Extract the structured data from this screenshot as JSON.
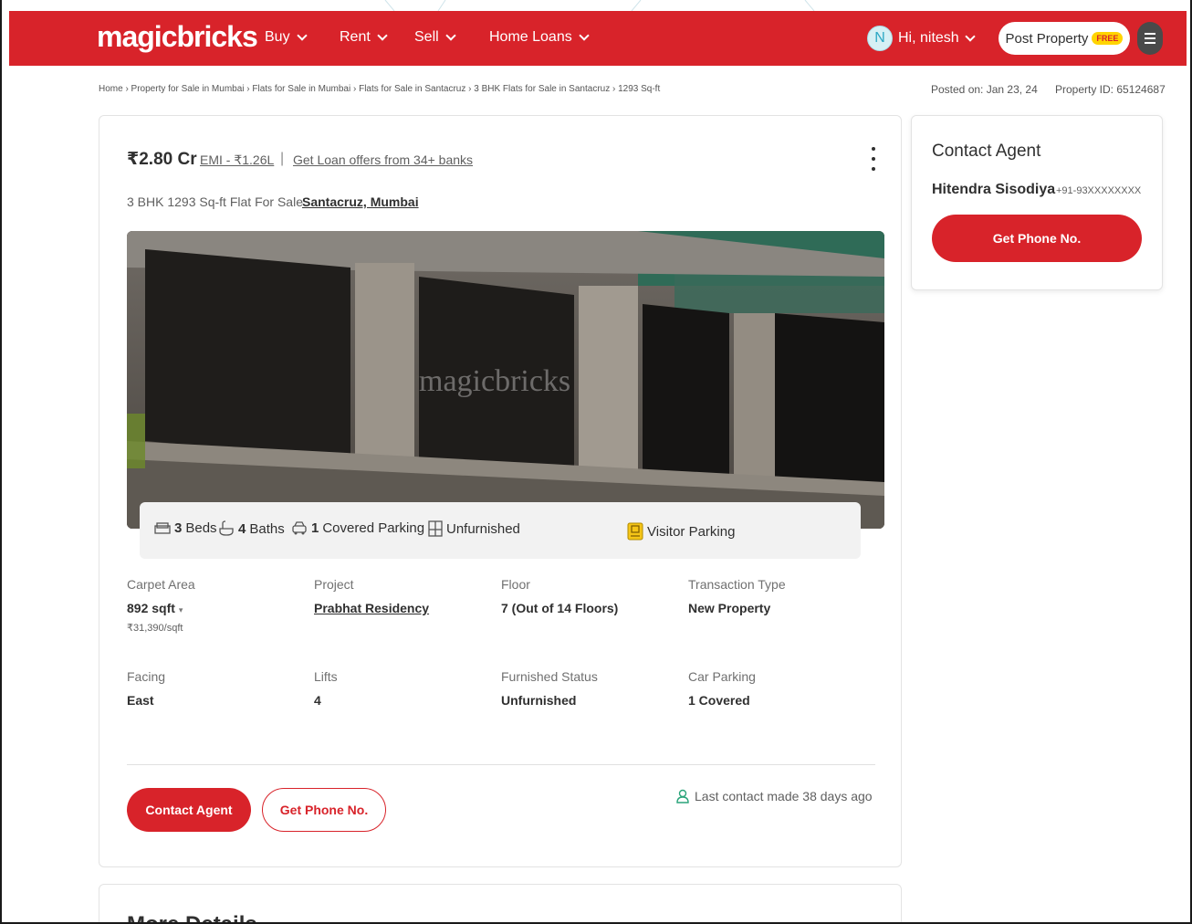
{
  "header": {
    "logo": "magicbricks",
    "nav": [
      "Buy",
      "Rent",
      "Sell",
      "Home Loans"
    ],
    "avatar_initial": "N",
    "greeting": "Hi, nitesh",
    "post_property": "Post Property",
    "free_badge": "FREE"
  },
  "breadcrumb": "Home › Property for Sale in Mumbai › Flats for Sale in Mumbai › Flats for Sale in Santacruz › 3 BHK Flats for Sale in Santacruz › 1293 Sq-ft",
  "posted_on": "Posted on: Jan 23, 24",
  "property_id": "Property ID: 65124687",
  "listing": {
    "price": "₹2.80 Cr",
    "emi": "EMI - ₹1.26L",
    "separator": "|",
    "loan_offer": "Get Loan offers from 34+ banks",
    "subtitle": "3 BHK 1293 Sq-ft Flat For Sale",
    "location": "Santacruz, Mumbai",
    "photo_watermark": "magicbricks"
  },
  "amenities": {
    "beds_count": "3",
    "beds_label": "Beds",
    "baths_count": "4",
    "baths_label": "Baths",
    "parking_count": "1",
    "parking_label": "Covered Parking",
    "furnishing": "Unfurnished",
    "visitor": "Visitor Parking"
  },
  "details": [
    {
      "label": "Carpet Area",
      "value": "892 sqft",
      "sub": "₹31,390/sqft"
    },
    {
      "label": "Project",
      "value": "Prabhat Residency"
    },
    {
      "label": "Floor",
      "value": "7 (Out of 14 Floors)"
    },
    {
      "label": "Transaction Type",
      "value": "New Property"
    },
    {
      "label": "Facing",
      "value": "East"
    },
    {
      "label": "Lifts",
      "value": "4"
    },
    {
      "label": "Furnished Status",
      "value": "Unfurnished"
    },
    {
      "label": "Car Parking",
      "value": "1 Covered"
    }
  ],
  "actions": {
    "contact_agent": "Contact Agent",
    "get_phone": "Get Phone No.",
    "last_contact": "Last contact made 38 days ago"
  },
  "more_details_title": "More Details",
  "agent_card": {
    "title": "Contact Agent",
    "name": "Hitendra Sisodiya",
    "phone": "+91-93XXXXXXXX",
    "button": "Get Phone No."
  },
  "colors": {
    "brand": "#d8232a",
    "badge": "#ffd400"
  }
}
